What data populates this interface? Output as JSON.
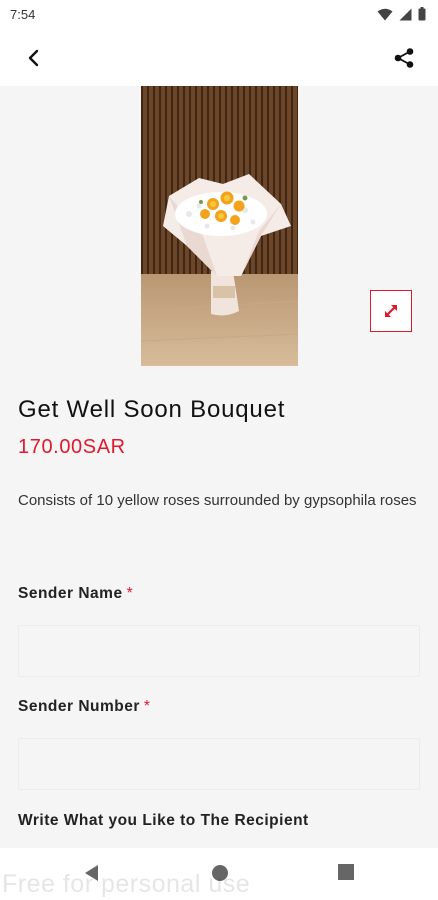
{
  "status_bar": {
    "time": "7:54",
    "icons": [
      "wifi-icon",
      "signal-icon",
      "battery-icon"
    ]
  },
  "app_bar": {
    "back_icon": "back-arrow-icon",
    "share_icon": "share-icon"
  },
  "product": {
    "title": "Get Well Soon Bouquet",
    "price": "170.00SAR",
    "description": "Consists of 10 yellow roses surrounded by gypsophila roses",
    "image_icon": "bouquet-photo",
    "expand_icon": "expand-icon"
  },
  "form": {
    "sender_name_label": "Sender Name",
    "sender_name_value": "",
    "sender_number_label": "Sender Number",
    "sender_number_value": "",
    "required_marker": "*",
    "message_label": "Write What you Like to The Recipient"
  },
  "nav_bar": {
    "icons": [
      "back-triangle-icon",
      "home-circle-icon",
      "recents-square-icon"
    ]
  },
  "watermark": "Free for personal use",
  "colors": {
    "accent": "#e0192d",
    "background": "#f5f5f5"
  }
}
